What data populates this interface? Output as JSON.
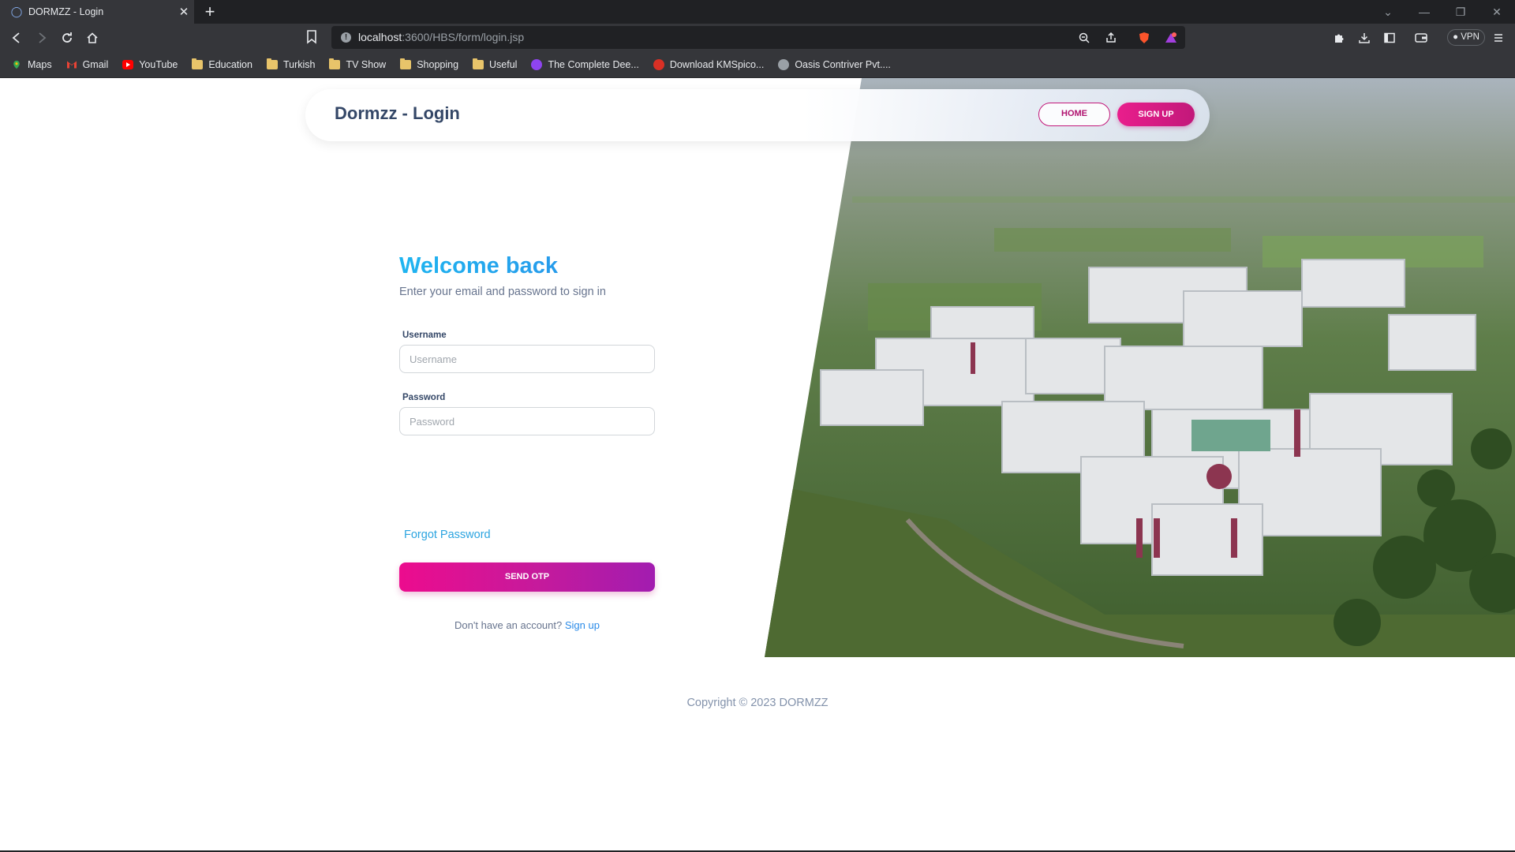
{
  "browser": {
    "tab_title": "DORMZZ - Login",
    "url_host": "localhost",
    "url_path": ":3600/HBS/form/login.jsp",
    "vpn_label": "VPN",
    "bookmarks": [
      {
        "label": "Maps",
        "icon": "maps-icon"
      },
      {
        "label": "Gmail",
        "icon": "gmail-icon"
      },
      {
        "label": "YouTube",
        "icon": "youtube-icon"
      },
      {
        "label": "Education",
        "icon": "folder-icon"
      },
      {
        "label": "Turkish",
        "icon": "folder-icon"
      },
      {
        "label": "TV Show",
        "icon": "folder-icon"
      },
      {
        "label": "Shopping",
        "icon": "folder-icon"
      },
      {
        "label": "Useful",
        "icon": "folder-icon"
      },
      {
        "label": "The Complete Dee...",
        "icon": "site-icon"
      },
      {
        "label": "Download KMSpico...",
        "icon": "site-icon"
      },
      {
        "label": "Oasis Contriver Pvt....",
        "icon": "site-icon"
      }
    ]
  },
  "navbar": {
    "brand": "Dormzz - Login",
    "home_label": "HOME",
    "signup_label": "SIGN UP"
  },
  "form": {
    "heading": "Welcome back",
    "subtitle": "Enter your email and password to sign in",
    "username_label": "Username",
    "username_placeholder": "Username",
    "password_label": "Password",
    "password_placeholder": "Password",
    "forgot_label": "Forgot Password",
    "submit_label": "SEND OTP",
    "no_account_text": "Don't have an account?",
    "signup_link": "Sign up"
  },
  "footer": {
    "copyright": "Copyright © 2023 DORMZZ"
  },
  "colors": {
    "accent_pink": "#e91e8c",
    "accent_blue": "#2b8be8",
    "text_dark": "#344767"
  }
}
